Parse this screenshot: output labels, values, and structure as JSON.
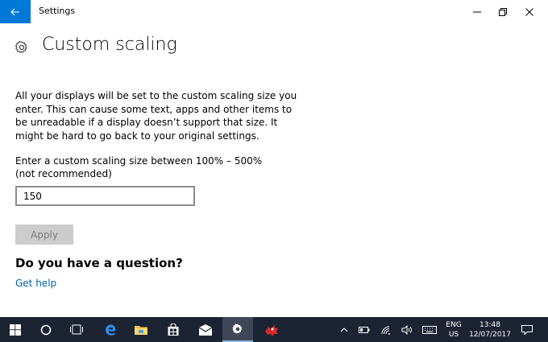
{
  "window": {
    "title": "Settings"
  },
  "page": {
    "title": "Custom scaling",
    "description": "All your displays will be set to the custom scaling size you enter. This can cause some text, apps and other items to be unreadable if a display doesn’t support that size. It might be hard to go back to your original settings.",
    "input_label": "Enter a custom scaling size between 100% – 500% (not recommended)",
    "input_value": "150",
    "apply_label": "Apply",
    "question_heading": "Do you have a question?",
    "help_link": "Get help"
  },
  "taskbar": {
    "apps": [
      "start-icon",
      "cortana-icon",
      "task-view-icon",
      "edge-icon",
      "file-explorer-icon",
      "store-icon",
      "mail-icon",
      "settings-icon",
      "app-icon"
    ],
    "tray": {
      "lang_top": "ENG",
      "lang_bottom": "US",
      "time": "13:48",
      "date": "12/07/2017"
    }
  },
  "colors": {
    "accent": "#0078d7",
    "link": "#0063b1",
    "taskbar": "#1c2333",
    "button_disabled": "#cccccc"
  }
}
